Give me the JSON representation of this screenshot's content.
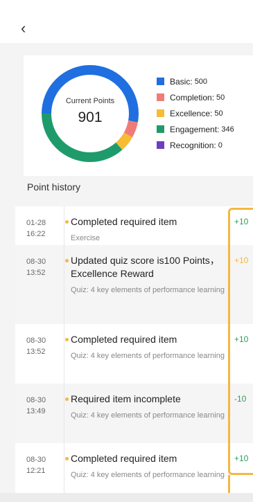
{
  "header": {
    "back_icon": "chevron-left-icon",
    "back_glyph": "‹"
  },
  "summary": {
    "center_label": "Current Points",
    "center_value": "901",
    "legend": [
      {
        "label": "Basic:",
        "value": "500",
        "color": "#1f6fe0"
      },
      {
        "label": "Completion:",
        "value": "50",
        "color": "#f07c78"
      },
      {
        "label": "Excellence:",
        "value": "50",
        "color": "#f7bc34"
      },
      {
        "label": "Engagement:",
        "value": "346",
        "color": "#1f9b6b"
      },
      {
        "label": "Recognition:",
        "value": "0",
        "color": "#6b3fbf"
      }
    ]
  },
  "chart_data": {
    "type": "pie",
    "categories": [
      "Basic",
      "Completion",
      "Excellence",
      "Engagement",
      "Recognition"
    ],
    "values": [
      500,
      50,
      50,
      346,
      0
    ],
    "colors": [
      "#1f6fe0",
      "#f07c78",
      "#f7bc34",
      "#1f9b6b",
      "#6b3fbf"
    ],
    "title": "",
    "legend_position": "right"
  },
  "history": {
    "title": "Point history",
    "items": [
      {
        "date": "01-28",
        "time": "16:22",
        "title": "Completed required item",
        "subtitle": "Exercise",
        "points": "+10",
        "points_color": "#2e9e5b"
      },
      {
        "date": "08-30",
        "time": "13:52",
        "title": "Updated quiz score is100 Points，Excellence Reward",
        "subtitle": "Quiz: 4 key elements of performance learning",
        "points": "+10",
        "points_color": "#f5b740"
      },
      {
        "date": "08-30",
        "time": "13:52",
        "title": "Completed required item",
        "subtitle": "Quiz: 4 key elements of performance learning",
        "points": "+10",
        "points_color": "#2e9e5b"
      },
      {
        "date": "08-30",
        "time": "13:49",
        "title": "Required item incomplete",
        "subtitle": "Quiz: 4 key elements of performance learning",
        "points": "-10",
        "points_color": "#2e9e5b"
      },
      {
        "date": "08-30",
        "time": "12:21",
        "title": "Completed required item",
        "subtitle": "Quiz: 4 key elements of performance learning",
        "points": "+10",
        "points_color": "#2e9e5b"
      }
    ]
  }
}
